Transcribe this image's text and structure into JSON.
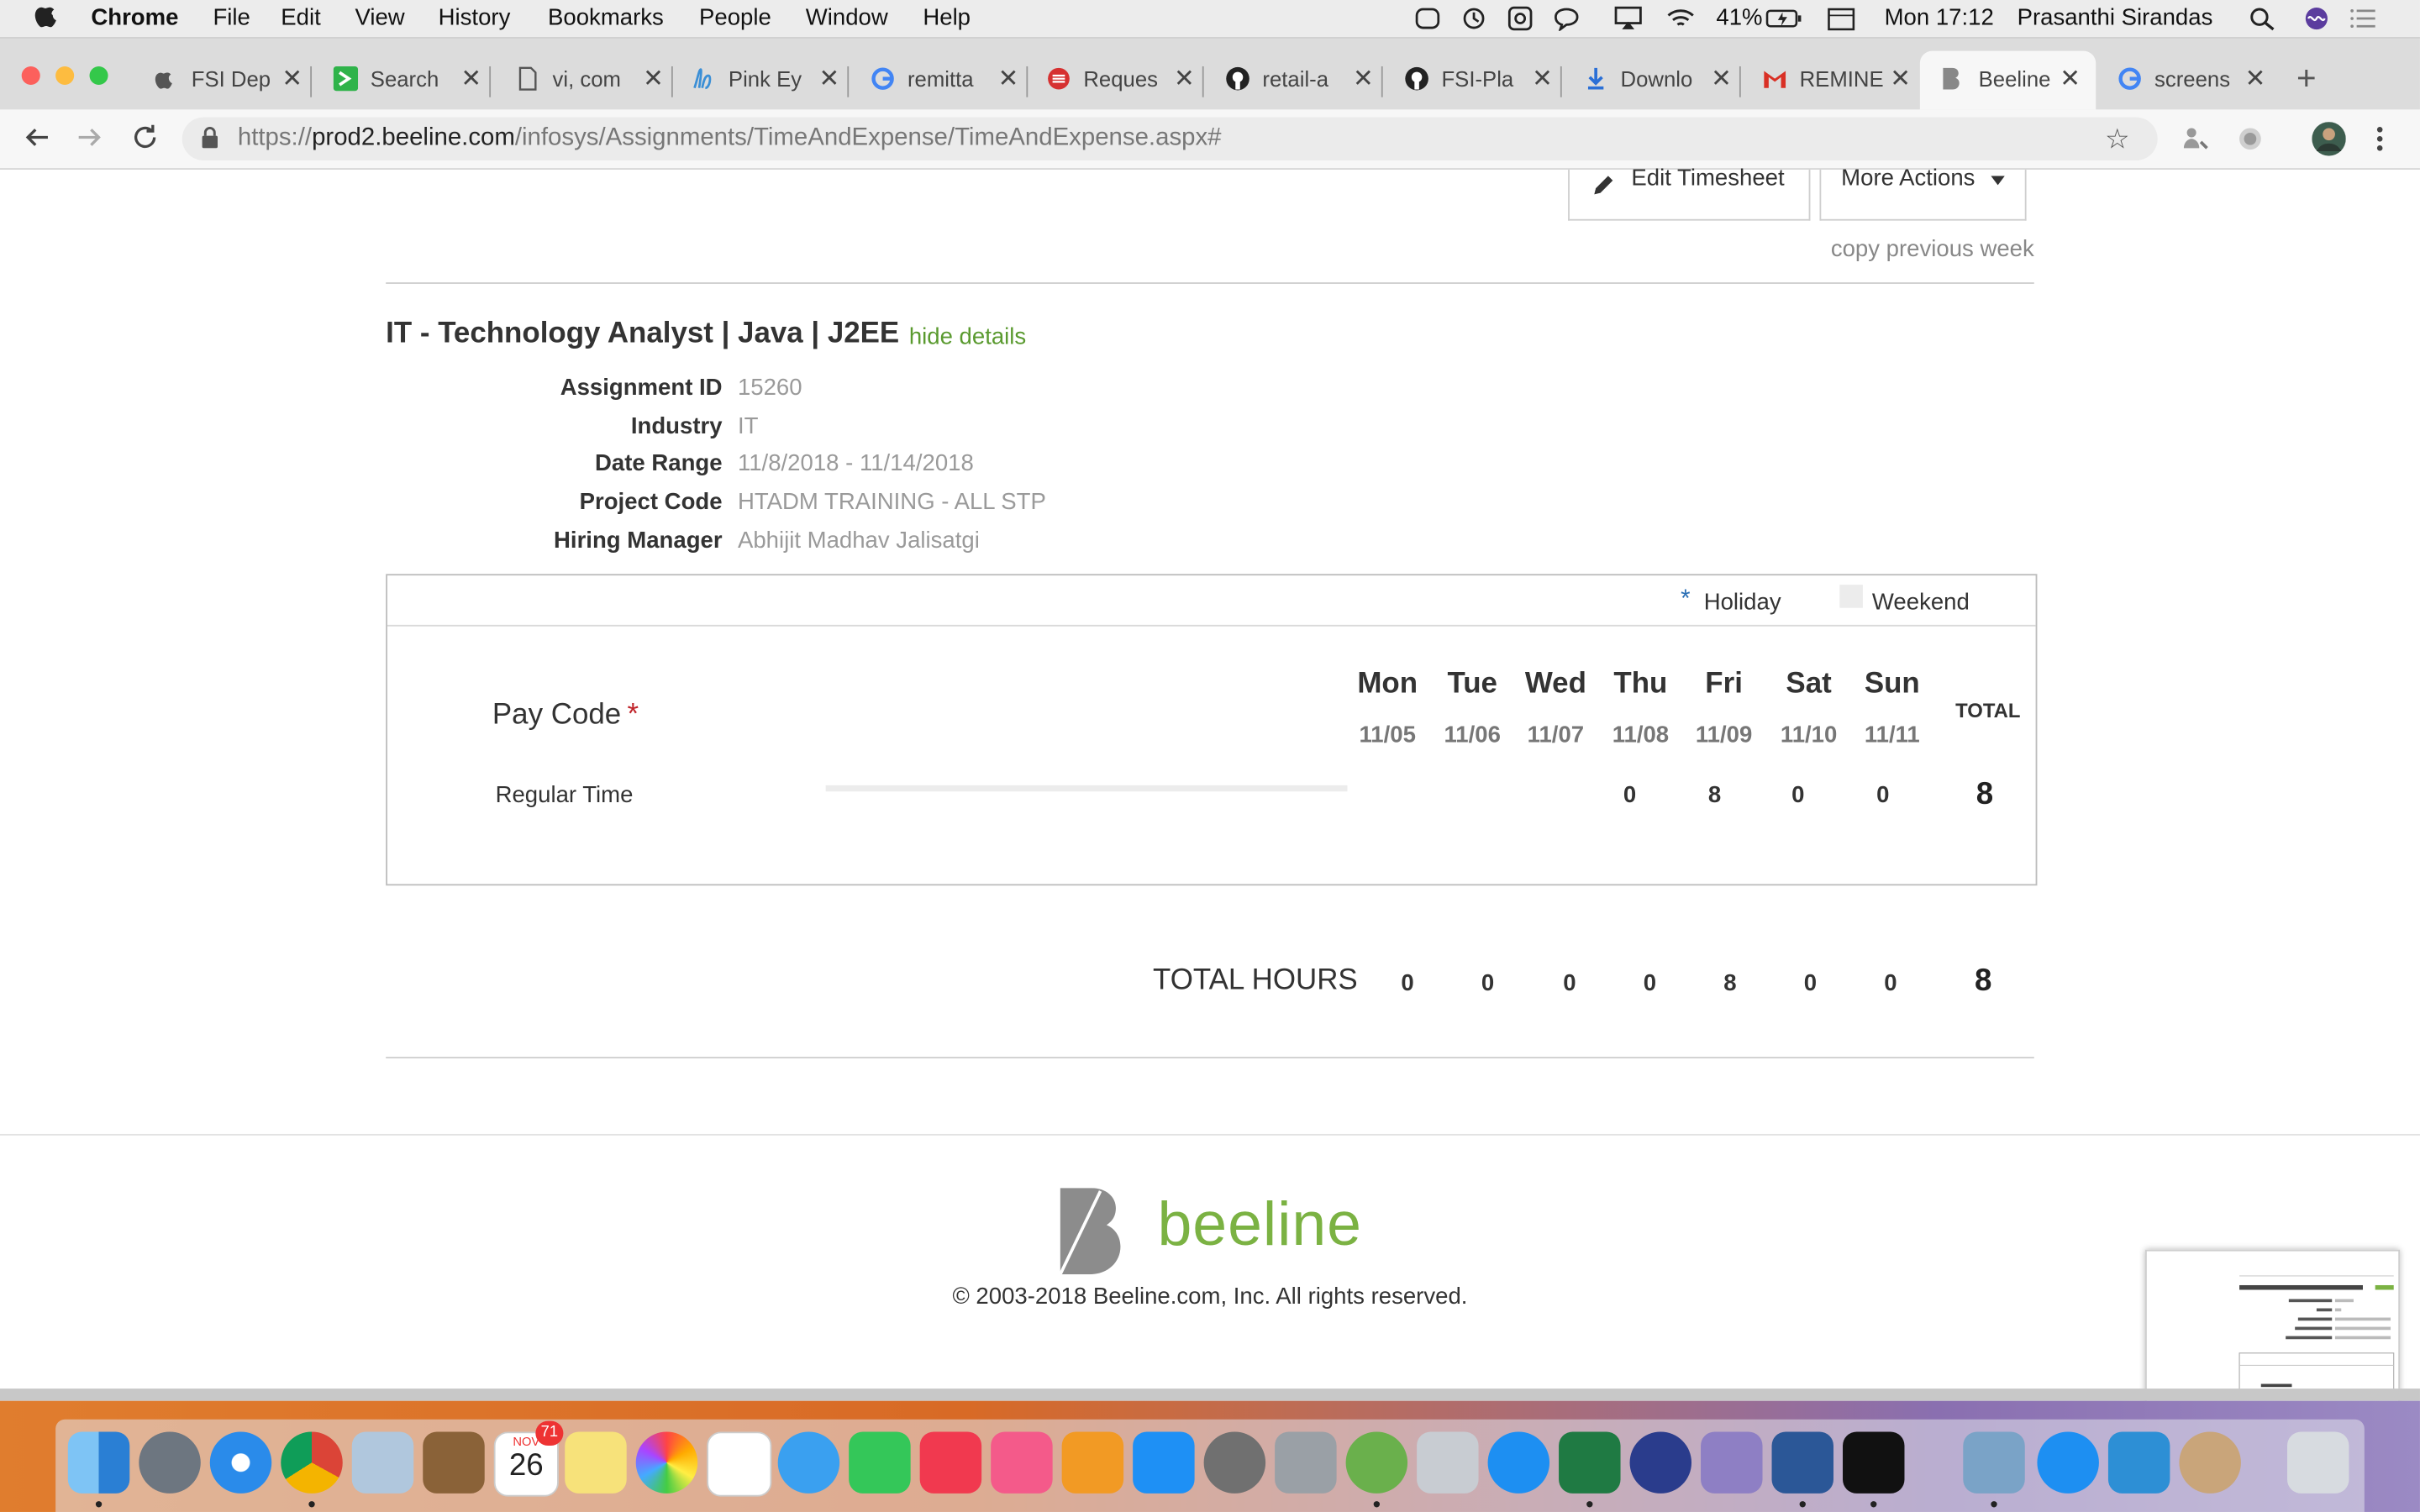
{
  "menubar": {
    "app_name": "Chrome",
    "menus": [
      "File",
      "Edit",
      "View",
      "History",
      "Bookmarks",
      "People",
      "Window",
      "Help"
    ],
    "battery": "41%",
    "clock": "Mon 17:12",
    "user": "Prasanthi Sirandas"
  },
  "tabs": [
    {
      "label": "FSI Dep",
      "icon": "apple-icon"
    },
    {
      "label": "Search",
      "icon": "search-app-icon"
    },
    {
      "label": "vi, com",
      "icon": "document-icon"
    },
    {
      "label": "Pink Ey",
      "icon": "bl-icon"
    },
    {
      "label": "remitta",
      "icon": "google-icon"
    },
    {
      "label": "Reques",
      "icon": "red-logo-icon"
    },
    {
      "label": "retail-a",
      "icon": "github-icon"
    },
    {
      "label": "FSI-Pla",
      "icon": "github-icon"
    },
    {
      "label": "Downlo",
      "icon": "download-icon"
    },
    {
      "label": "REMINE",
      "icon": "gmail-icon"
    },
    {
      "label": "Beeline",
      "icon": "beeline-icon",
      "active": true
    },
    {
      "label": "screens",
      "icon": "google-icon"
    }
  ],
  "address_bar": {
    "scheme": "https://",
    "host": "prod2.beeline.com",
    "path": "/infosys/Assignments/TimeAndExpense/TimeAndExpense.aspx#"
  },
  "actions": {
    "edit_timesheet": "Edit Timesheet",
    "more_actions": "More Actions",
    "copy_previous_week": "copy previous week"
  },
  "assignment": {
    "title": "IT - Technology Analyst | Java | J2EE",
    "hide_details": "hide details",
    "details": [
      {
        "label": "Assignment ID",
        "value": "15260"
      },
      {
        "label": "Industry",
        "value": "IT"
      },
      {
        "label": "Date Range",
        "value": "11/8/2018 - 11/14/2018"
      },
      {
        "label": "Project Code",
        "value": "HTADM TRAINING - ALL STP"
      },
      {
        "label": "Hiring Manager",
        "value": "Abhijit Madhav Jalisatgi"
      }
    ]
  },
  "timesheet": {
    "legend_holiday_mark": "*",
    "legend_holiday": "Holiday",
    "legend_weekend": "Weekend",
    "paycode_label": "Pay Code",
    "required_mark": "*",
    "total_header": "TOTAL",
    "days": [
      {
        "name": "Mon",
        "date": "11/05"
      },
      {
        "name": "Tue",
        "date": "11/06"
      },
      {
        "name": "Wed",
        "date": "11/07"
      },
      {
        "name": "Thu",
        "date": "11/08"
      },
      {
        "name": "Fri",
        "date": "11/09"
      },
      {
        "name": "Sat",
        "date": "11/10"
      },
      {
        "name": "Sun",
        "date": "11/11"
      }
    ],
    "rows": [
      {
        "pay_code": "Regular Time",
        "hours": [
          "",
          "",
          "",
          "0",
          "8",
          "0",
          "0"
        ],
        "total": "8"
      }
    ],
    "total_hours_label": "TOTAL HOURS",
    "total_hours": [
      "0",
      "0",
      "0",
      "0",
      "8",
      "0",
      "0"
    ],
    "grand_total": "8"
  },
  "footer": {
    "logo_text": "beeline",
    "copyright": "© 2003-2018 Beeline.com, Inc. All rights reserved."
  },
  "dock": {
    "calendar_month": "NOV",
    "calendar_day": "26",
    "calendar_badge": "71"
  },
  "colors": {
    "link_green": "#5a9a2f",
    "brand_green": "#7bb243",
    "required_red": "#c0252b",
    "holiday_blue": "#2a6fb5"
  }
}
